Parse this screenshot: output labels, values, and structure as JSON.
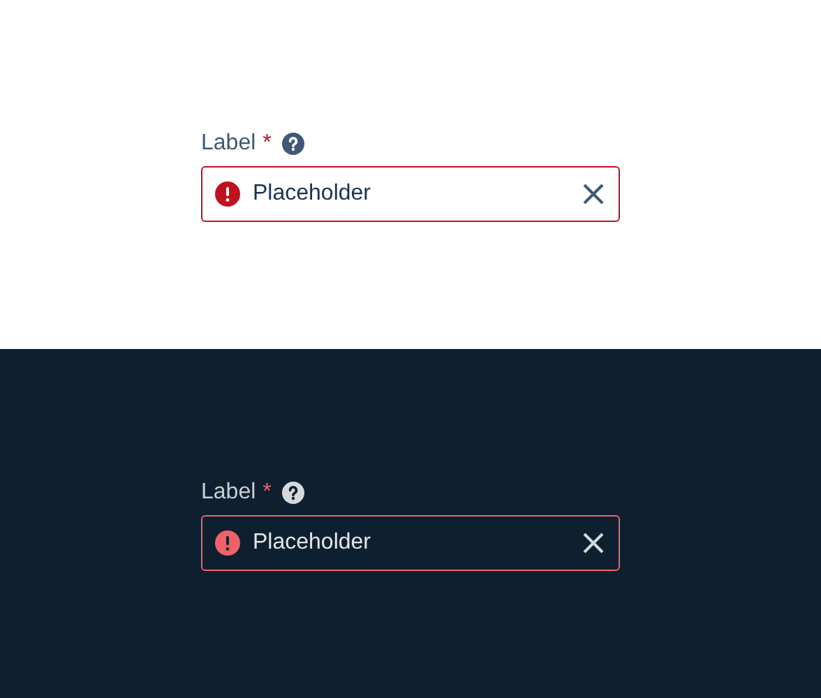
{
  "panels": [
    {
      "kind": "light",
      "label": "Label",
      "required_mark": "*",
      "field": {
        "placeholder": "Placeholder",
        "error": true
      }
    },
    {
      "kind": "dark",
      "label": "Label",
      "required_mark": "*",
      "field": {
        "placeholder": "Placeholder",
        "error": true
      }
    }
  ]
}
